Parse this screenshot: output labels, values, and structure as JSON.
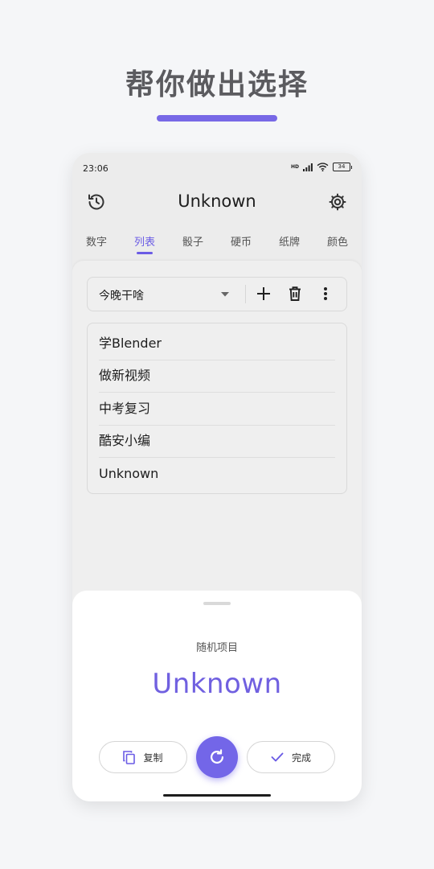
{
  "promo": {
    "headline": "帮你做出选择",
    "accent_color": "#7768e6"
  },
  "status_bar": {
    "time": "23:06",
    "network_label": "HD",
    "battery": "34",
    "icons": [
      "signal-icon",
      "wifi-icon",
      "battery-icon"
    ]
  },
  "app_bar": {
    "title": "Unknown",
    "left_icon": "history-icon",
    "right_icon": "gear-icon"
  },
  "tabs": [
    {
      "label": "数字",
      "active": false
    },
    {
      "label": "列表",
      "active": true
    },
    {
      "label": "骰子",
      "active": false
    },
    {
      "label": "硬币",
      "active": false
    },
    {
      "label": "纸牌",
      "active": false
    },
    {
      "label": "颜色",
      "active": false
    }
  ],
  "toolbar": {
    "selected_list": "今晚干啥",
    "actions": [
      "plus-icon",
      "trash-icon",
      "more-vert-icon"
    ]
  },
  "list_items": [
    "学Blender",
    "做新视频",
    "中考复习",
    "酷安小编",
    "Unknown"
  ],
  "result_sheet": {
    "label": "随机项目",
    "result": "Unknown",
    "copy_label": "复制",
    "done_label": "完成",
    "accent_color": "#7366e8"
  }
}
